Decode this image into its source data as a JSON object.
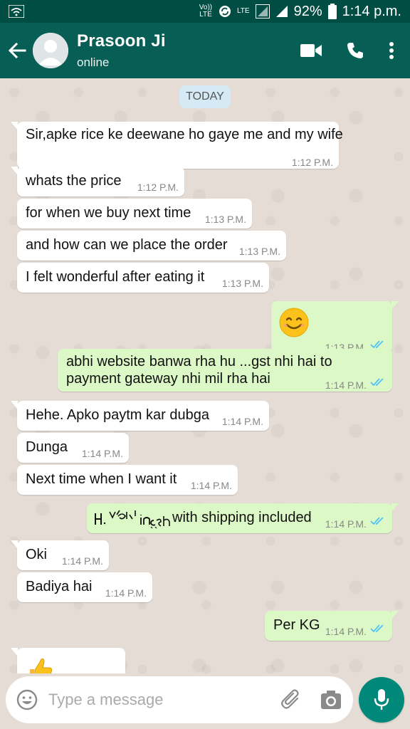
{
  "status_bar": {
    "volte": "Vo)) LTE",
    "lte": "LTE",
    "battery": "92%",
    "time": "1:14 p.m."
  },
  "header": {
    "name": "Prasoon Ji",
    "status": "online"
  },
  "date_chip": "TODAY",
  "messages": [
    {
      "dir": "in",
      "text": "Sir,apke rice ke deewane ho gaye me and my wife",
      "time": "1:12 P.M."
    },
    {
      "dir": "in",
      "text": "whats the price",
      "time": "1:12 P.M."
    },
    {
      "dir": "in",
      "text": "for when we buy next time",
      "time": "1:13 P.M."
    },
    {
      "dir": "in",
      "text": "and how can we place the order",
      "time": "1:13 P.M."
    },
    {
      "dir": "in",
      "text": "I felt wonderful after eating it",
      "time": "1:13 P.M."
    },
    {
      "dir": "out",
      "emoji": "smiling-face",
      "time": "1:13 P.M."
    },
    {
      "dir": "out",
      "text_lines": [
        "abhi website banwa rha hu ...gst nhi hai to",
        "payment gateway nhi mil rha hai"
      ],
      "time": "1:14 P.M."
    },
    {
      "dir": "in",
      "text": "Hehe. Apko paytm kar dubga",
      "time": "1:14 P.M."
    },
    {
      "dir": "in",
      "text": "Dunga",
      "time": "1:14 P.M."
    },
    {
      "dir": "in",
      "text": "Next time when I want it",
      "time": "1:14 P.M."
    },
    {
      "dir": "out",
      "text": "with shipping included",
      "time": "1:14 P.M."
    },
    {
      "dir": "in",
      "text": "Oki",
      "time": "1:14 P.M."
    },
    {
      "dir": "in",
      "text": "Badiya hai",
      "time": "1:14 P.M."
    },
    {
      "dir": "out",
      "text": "Per KG",
      "time": "1:14 P.M."
    },
    {
      "dir": "in",
      "emoji": "thumbs-up"
    }
  ],
  "input": {
    "placeholder": "Type a message"
  },
  "icons": {
    "back": "arrow-left-icon",
    "video": "video-camera-icon",
    "call": "phone-icon",
    "menu": "more-vertical-icon",
    "emoji": "emoji-icon",
    "attach": "paperclip-icon",
    "camera": "camera-icon",
    "mic": "microphone-icon"
  },
  "colors": {
    "header": "#075e54",
    "status_bar": "#004d43",
    "incoming": "#ffffff",
    "outgoing": "#dcf8c6",
    "ticks": "#4fc3f7",
    "mic_button": "#00897b"
  }
}
